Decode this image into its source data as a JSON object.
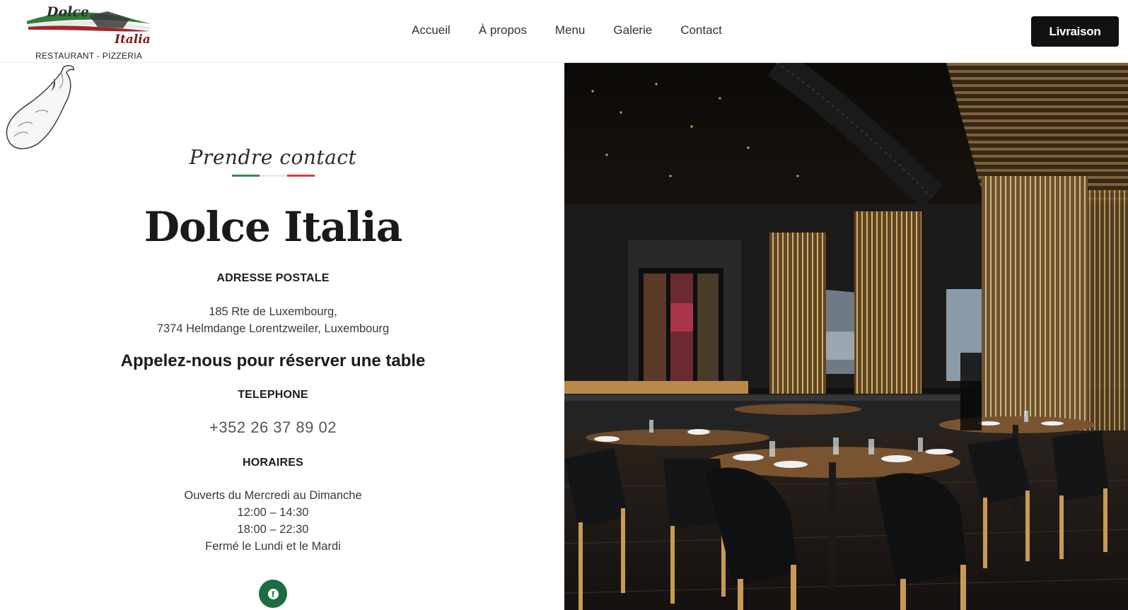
{
  "header": {
    "logo": {
      "word1": "Dolce",
      "word2": "Italia",
      "tagline": "RESTAURANT - PIZZERIA"
    },
    "nav": [
      {
        "label": "Accueil"
      },
      {
        "label": "À propos"
      },
      {
        "label": "Menu"
      },
      {
        "label": "Galerie"
      },
      {
        "label": "Contact"
      }
    ],
    "cta_label": "Livraison"
  },
  "contact": {
    "kicker": "Prendre contact",
    "title": "Dolce Italia",
    "address_label": "ADRESSE POSTALE",
    "address_line1": "185 Rte de Luxembourg,",
    "address_line2": "7374 Helmdange Lorentzweiler, Luxembourg",
    "reserve_heading": "Appelez-nous pour réserver une table",
    "phone_label": "TELEPHONE",
    "phone": "+352 26 37 89 02",
    "hours_label": "HORAIRES",
    "hours": [
      "Ouverts du Mercredi au Dimanche",
      "12:00 – 14:30",
      "18:00 – 22:30",
      "Fermé le Lundi et le Mardi"
    ],
    "social_icon": "facebook-icon"
  },
  "colors": {
    "accent_dark": "#111111",
    "flag_green": "#3f8a4a",
    "flag_white": "#e8e8e8",
    "flag_red": "#d1433c",
    "social_green": "#1b6b43"
  }
}
